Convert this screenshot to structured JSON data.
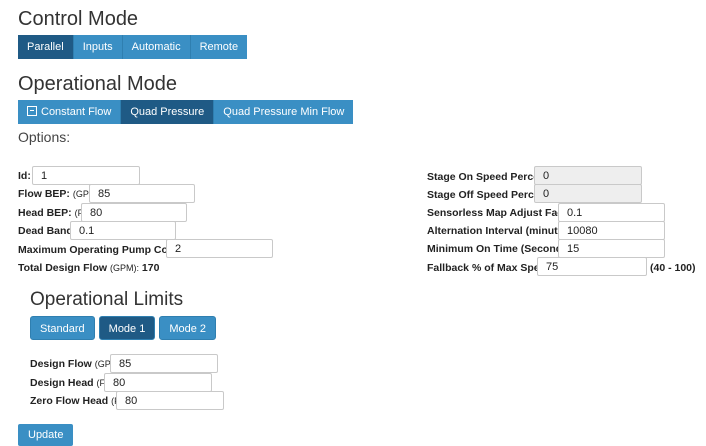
{
  "control_mode": {
    "title": "Control Mode",
    "tabs": [
      "Parallel",
      "Inputs",
      "Automatic",
      "Remote"
    ]
  },
  "operational_mode": {
    "title": "Operational Mode",
    "tabs": [
      "Constant Flow",
      "Quad Pressure",
      "Quad Pressure Min Flow"
    ],
    "options_label": "Options:"
  },
  "left_fields": {
    "id": {
      "label": "Id:",
      "value": "1"
    },
    "flow_bep": {
      "label": "Flow BEP:",
      "unit": "(GPM)",
      "value": "85"
    },
    "head_bep": {
      "label": "Head BEP:",
      "unit": "(FT)",
      "value": "80"
    },
    "dead_band": {
      "label": "Dead Band:",
      "value": "0.1"
    },
    "max_pump_count": {
      "label": "Maximum Operating Pump Count:",
      "value": "2"
    },
    "total_design_flow": {
      "label": "Total Design Flow",
      "unit": "(GPM):",
      "value": "170"
    }
  },
  "right_fields": {
    "stage_on": {
      "label": "Stage On Speed Percent:",
      "value": "0"
    },
    "stage_off": {
      "label": "Stage Off Speed Percent:",
      "value": "0"
    },
    "sensorless": {
      "label": "Sensorless Map Adjust Factor:",
      "value": "0.1"
    },
    "alternation": {
      "label": "Alternation Interval (minutes):",
      "value": "10080"
    },
    "min_on_time": {
      "label": "Minimum On Time (Seconds):",
      "value": "15"
    },
    "fallback": {
      "label": "Fallback % of Max Speed:",
      "value": "75",
      "range": "(40 - 100)"
    }
  },
  "operational_limits": {
    "title": "Operational Limits",
    "tabs": [
      "Standard",
      "Mode 1",
      "Mode 2"
    ],
    "design_flow": {
      "label": "Design Flow",
      "unit": "(GPM)",
      "value": "85"
    },
    "design_head": {
      "label": "Design Head",
      "unit": "(FT)",
      "value": "80"
    },
    "zero_flow_head": {
      "label": "Zero Flow Head",
      "unit": "(FT)",
      "value": "80"
    }
  },
  "update_label": "Update",
  "colors": {
    "button": "#3a8fc4",
    "active": "#1f5a85"
  }
}
